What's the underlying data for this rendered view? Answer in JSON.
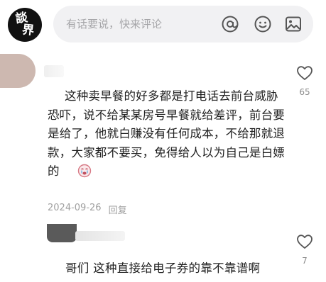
{
  "header": {
    "avatar_glyphs": [
      "談",
      "界"
    ],
    "comment_placeholder": "有话要说，快来评论",
    "icons": [
      "at-icon",
      "emoji-icon",
      "image-icon"
    ]
  },
  "comment": {
    "text": "这种卖早餐的好多都是打电话去前台威胁恐吓，说不给某某房号早餐就给差评，前台要是给了，他就白赚没有任何成本，不给那就退款，大家都不要买，免得给人以为自己是白嫖的",
    "emoji": "crying-face-emoji",
    "date": "2024-09-26",
    "reply_label": "回复",
    "like_count": "65"
  },
  "reply": {
    "text": "哥们 这种直接给电子券的靠不靠谱啊",
    "like_count": "7"
  },
  "colors": {
    "background": "#ffffff",
    "input_bg": "#f1f1f3",
    "muted_text": "#a0a0a0"
  }
}
